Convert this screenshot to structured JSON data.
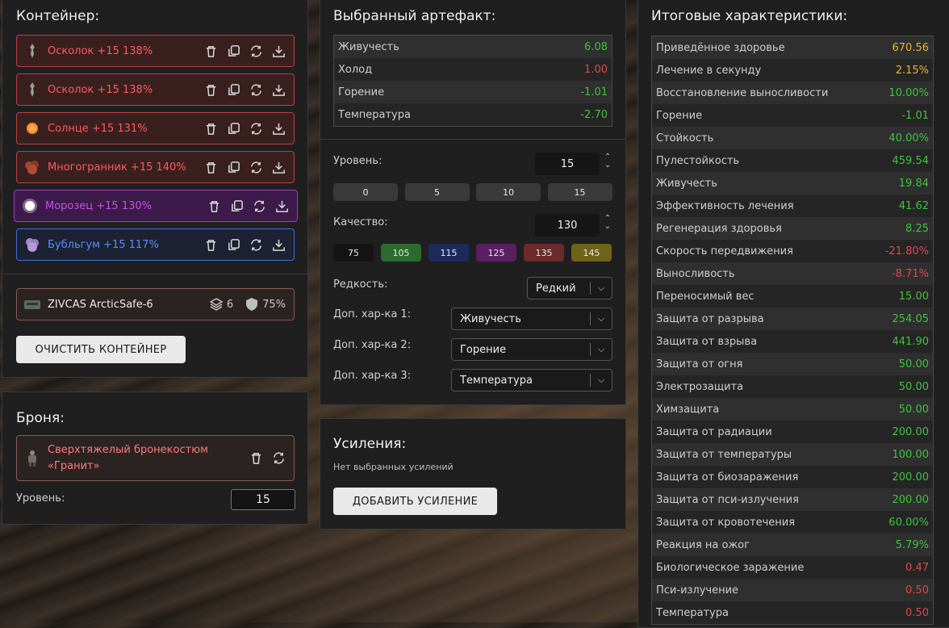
{
  "container": {
    "title": "Контейнер:",
    "artifacts": [
      {
        "name": "Осколок +15 138%",
        "icon": "shard-icon",
        "color": "red"
      },
      {
        "name": "Осколок +15 138%",
        "icon": "shard-icon",
        "color": "red"
      },
      {
        "name": "Солнце +15 131%",
        "icon": "sun-icon",
        "color": "red"
      },
      {
        "name": "Многогранник +15 140%",
        "icon": "polyhedron-icon",
        "color": "red"
      },
      {
        "name": "Морозец +15 130%",
        "icon": "frost-icon",
        "color": "purple"
      },
      {
        "name": "Бубльгум +15 117%",
        "icon": "bubblegum-icon",
        "color": "blue"
      }
    ],
    "case": {
      "name": "ZIVCAS ArcticSafe-6",
      "slots": "6",
      "protection": "75%"
    },
    "clear_button": "ОЧИСТИТЬ КОНТЕЙНЕР"
  },
  "armor": {
    "title": "Броня:",
    "name": "Сверхтяжелый бронекостюм «Гранит»",
    "level_label": "Уровень:",
    "level_value": "15"
  },
  "artifact": {
    "title": "Выбранный артефакт:",
    "stats": [
      {
        "label": "Живучесть",
        "value": "6.08",
        "tone": "g"
      },
      {
        "label": "Холод",
        "value": "1.00",
        "tone": "r"
      },
      {
        "label": "Горение",
        "value": "-1.01",
        "tone": "g"
      },
      {
        "label": "Температура",
        "value": "-2.70",
        "tone": "g"
      }
    ],
    "level_label": "Уровень:",
    "level_value": "15",
    "level_presets": [
      "0",
      "5",
      "10",
      "15"
    ],
    "quality_label": "Качество:",
    "quality_value": "130",
    "quality_presets": [
      {
        "label": "75",
        "color": "#141414"
      },
      {
        "label": "105",
        "color": "#2c6b2e"
      },
      {
        "label": "115",
        "color": "#1e2a5c"
      },
      {
        "label": "125",
        "color": "#5a1e63"
      },
      {
        "label": "135",
        "color": "#6b2b2b"
      },
      {
        "label": "145",
        "color": "#6e6418"
      }
    ],
    "rarity_label": "Редкость:",
    "rarity_value": "Редкий",
    "extra1_label": "Доп. хар-ка 1:",
    "extra1_value": "Живучесть",
    "extra2_label": "Доп. хар-ка 2:",
    "extra2_value": "Горение",
    "extra3_label": "Доп. хар-ка 3:",
    "extra3_value": "Температура"
  },
  "boosts": {
    "title": "Усиления:",
    "empty_text": "Нет выбранных усилений",
    "add_button": "ДОБАВИТЬ УСИЛЕНИЕ"
  },
  "totals": {
    "title": "Итоговые характеристики:",
    "rows": [
      {
        "label": "Приведённое здоровье",
        "value": "670.56",
        "tone": "y"
      },
      {
        "label": "Лечение в секунду",
        "value": "2.15%",
        "tone": "y"
      },
      {
        "label": "Восстановление выносливости",
        "value": "10.00%",
        "tone": "g"
      },
      {
        "label": "Горение",
        "value": "-1.01",
        "tone": "g"
      },
      {
        "label": "Стойкость",
        "value": "40.00%",
        "tone": "g"
      },
      {
        "label": "Пулестойкость",
        "value": "459.54",
        "tone": "g"
      },
      {
        "label": "Живучесть",
        "value": "19.84",
        "tone": "g"
      },
      {
        "label": "Эффективность лечения",
        "value": "41.62",
        "tone": "g"
      },
      {
        "label": "Регенерация здоровья",
        "value": "8.25",
        "tone": "g"
      },
      {
        "label": "Скорость передвижения",
        "value": "-21.80%",
        "tone": "r"
      },
      {
        "label": "Выносливость",
        "value": "-8.71%",
        "tone": "r"
      },
      {
        "label": "Переносимый вес",
        "value": "15.00",
        "tone": "g"
      },
      {
        "label": "Защита от разрыва",
        "value": "254.05",
        "tone": "g"
      },
      {
        "label": "Защита от взрыва",
        "value": "441.90",
        "tone": "g"
      },
      {
        "label": "Защита от огня",
        "value": "50.00",
        "tone": "g"
      },
      {
        "label": "Электрозащита",
        "value": "50.00",
        "tone": "g"
      },
      {
        "label": "Химзащита",
        "value": "50.00",
        "tone": "g"
      },
      {
        "label": "Защита от радиации",
        "value": "200.00",
        "tone": "g"
      },
      {
        "label": "Защита от температуры",
        "value": "100.00",
        "tone": "g"
      },
      {
        "label": "Защита от биозаражения",
        "value": "200.00",
        "tone": "g"
      },
      {
        "label": "Защита от пси-излучения",
        "value": "200.00",
        "tone": "g"
      },
      {
        "label": "Защита от кровотечения",
        "value": "60.00%",
        "tone": "g"
      },
      {
        "label": "Реакция на ожог",
        "value": "5.79%",
        "tone": "g"
      },
      {
        "label": "Биологическое заражение",
        "value": "0.47",
        "tone": "r"
      },
      {
        "label": "Пси-излучение",
        "value": "0.50",
        "tone": "r"
      },
      {
        "label": "Температура",
        "value": "0.50",
        "tone": "r"
      }
    ]
  }
}
